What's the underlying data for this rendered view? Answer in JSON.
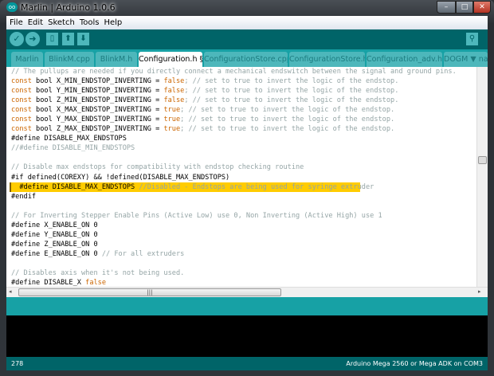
{
  "window": {
    "title": "Marlin | Arduino 1.0.6",
    "app_icon": "infinity-icon"
  },
  "menu": [
    "File",
    "Edit",
    "Sketch",
    "Tools",
    "Help"
  ],
  "toolbar": {
    "verify": "✓",
    "upload": "➜",
    "new": "▯",
    "open": "⬆",
    "save": "⬇",
    "serial_monitor": "⚲"
  },
  "tabs": [
    {
      "label": "Marlin"
    },
    {
      "label": "BlinkM.cpp"
    },
    {
      "label": "BlinkM.h"
    },
    {
      "label": "Configuration.h §",
      "active": true
    },
    {
      "label": "ConfigurationStore.cpp"
    },
    {
      "label": "ConfigurationStore.h"
    },
    {
      "label": "Configuration_adv.h"
    },
    {
      "label": "DOGM ▼ na"
    }
  ],
  "colors": {
    "keyword": "#cc6600",
    "comment": "#95a5a6",
    "highlight": "#ffcc00",
    "teal": "#17a1a5",
    "dark_teal": "#006468"
  },
  "code": [
    [
      [
        "// The pullups are needed if you directly connect a mechanical endswitch between the signal and ground pins.",
        "cm"
      ]
    ],
    [
      [
        "const",
        "kw"
      ],
      [
        " bool X_MIN_ENDSTOP_INVERTING = ",
        "tx"
      ],
      [
        "false",
        "kw"
      ],
      [
        "; // set to true to invert the logic of the endstop.",
        "cm"
      ]
    ],
    [
      [
        "const",
        "kw"
      ],
      [
        " bool Y_MIN_ENDSTOP_INVERTING = ",
        "tx"
      ],
      [
        "false",
        "kw"
      ],
      [
        "; // set to true to invert the logic of the endstop.",
        "cm"
      ]
    ],
    [
      [
        "const",
        "kw"
      ],
      [
        " bool Z_MIN_ENDSTOP_INVERTING = ",
        "tx"
      ],
      [
        "false",
        "kw"
      ],
      [
        "; // set to true to invert the logic of the endstop.",
        "cm"
      ]
    ],
    [
      [
        "const",
        "kw"
      ],
      [
        " bool X_MAX_ENDSTOP_INVERTING = ",
        "tx"
      ],
      [
        "true",
        "kw"
      ],
      [
        "; // set to true to invert the logic of the endstop.",
        "cm"
      ]
    ],
    [
      [
        "const",
        "kw"
      ],
      [
        " bool Y_MAX_ENDSTOP_INVERTING = ",
        "tx"
      ],
      [
        "true",
        "kw"
      ],
      [
        "; // set to true to invert the logic of the endstop.",
        "cm"
      ]
    ],
    [
      [
        "const",
        "kw"
      ],
      [
        " bool Z_MAX_ENDSTOP_INVERTING = ",
        "tx"
      ],
      [
        "true",
        "kw"
      ],
      [
        "; // set to true to invert the logic of the endstop.",
        "cm"
      ]
    ],
    [
      [
        "#define DISABLE_MAX_ENDSTOPS",
        "tx"
      ]
    ],
    [
      [
        "//#define DISABLE_MIN_ENDSTOPS",
        "cm"
      ]
    ],
    [],
    [
      [
        "// Disable max endstops for compatibility with endstop checking routine",
        "cm"
      ]
    ],
    [
      [
        "#if defined(COREXY) && !defined(DISABLE_MAX_ENDSTOPS)",
        "tx"
      ]
    ],
    [
      [
        "  #define DISABLE_MAX_ENDSTOPS ",
        "tx"
      ],
      [
        "//Disabled - Endstops are being used for syringe extruder",
        "cm"
      ]
    ],
    [
      [
        "#endif",
        "tx"
      ]
    ],
    [],
    [
      [
        "// For Inverting Stepper Enable Pins (Active Low) use 0, Non Inverting (Active High) use 1",
        "cm"
      ]
    ],
    [
      [
        "#define X_ENABLE_ON 0",
        "tx"
      ]
    ],
    [
      [
        "#define Y_ENABLE_ON 0",
        "tx"
      ]
    ],
    [
      [
        "#define Z_ENABLE_ON 0",
        "tx"
      ]
    ],
    [
      [
        "#define E_ENABLE_ON 0 ",
        "tx"
      ],
      [
        "// For all extruders",
        "cm"
      ]
    ],
    [],
    [
      [
        "// Disables axis when it's not being used.",
        "cm"
      ]
    ],
    [
      [
        "#define DISABLE_X ",
        "tx"
      ],
      [
        "false",
        "kw"
      ]
    ]
  ],
  "highlighted_line": 12,
  "status": {
    "line": "278",
    "board": "Arduino Mega 2560 or Mega ADK on COM3"
  }
}
